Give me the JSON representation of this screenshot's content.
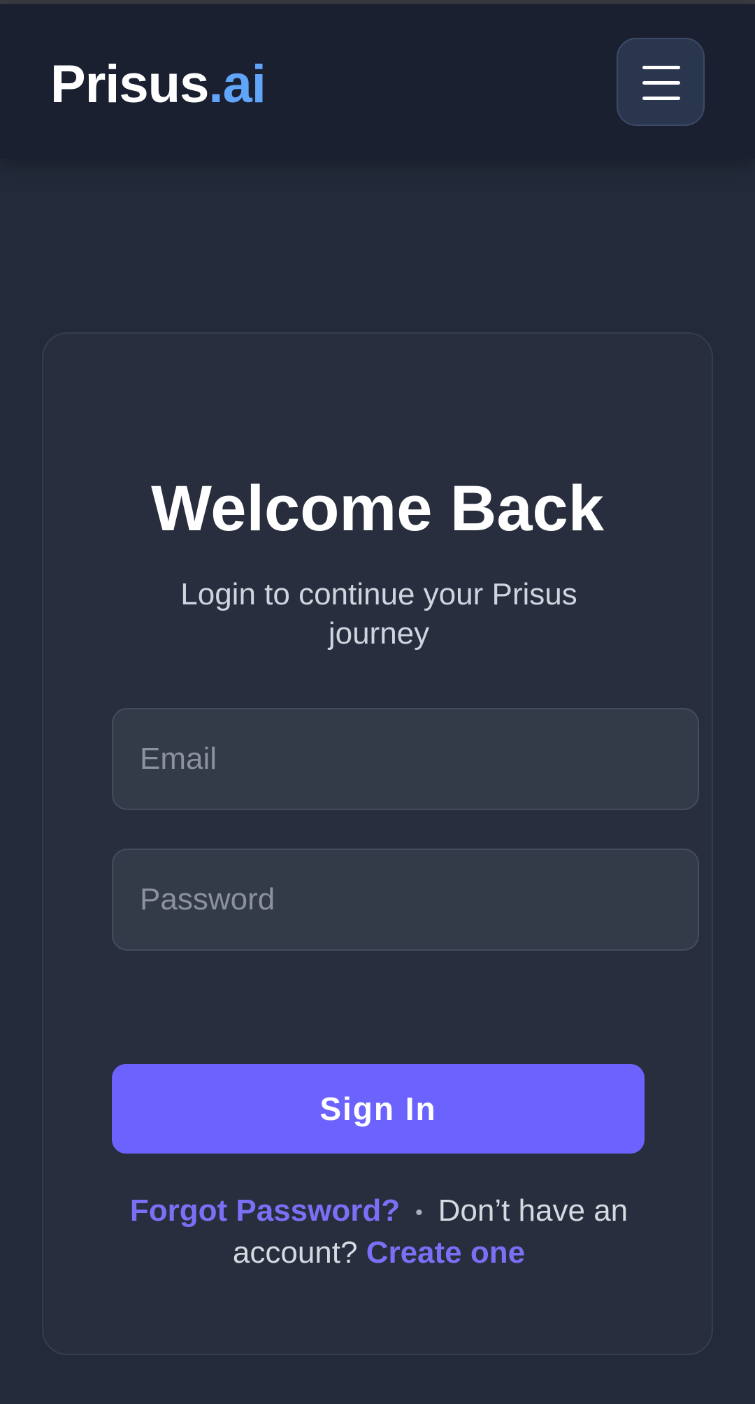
{
  "header": {
    "logo_main": "Prisus",
    "logo_accent": ".ai",
    "menu_icon": "hamburger-menu-icon"
  },
  "login": {
    "title": "Welcome Back",
    "subtitle": "Login to continue your Prisus journey",
    "email_placeholder": "Email",
    "password_placeholder": "Password",
    "signin_label": "Sign In",
    "forgot_label": "Forgot Password?",
    "separator": "•",
    "no_account_text": "Don’t have an account?",
    "create_label": "Create one"
  },
  "colors": {
    "accent": "#6c63ff",
    "logo_accent": "#60a5fa",
    "background": "#232a39"
  }
}
